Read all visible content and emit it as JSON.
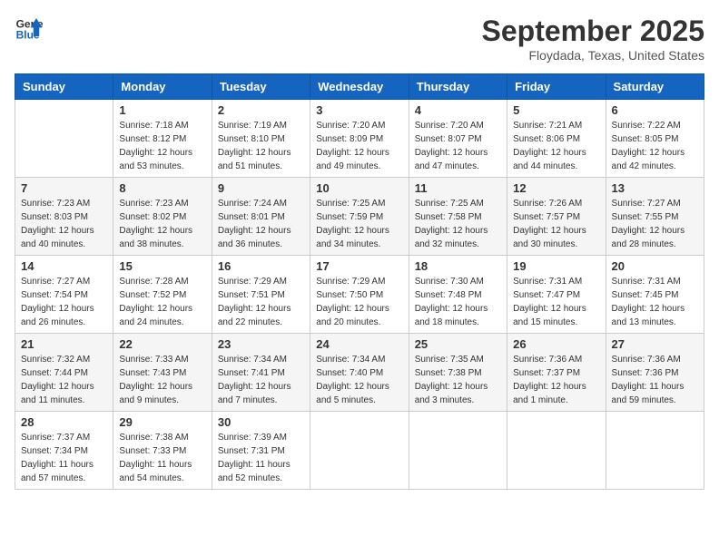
{
  "header": {
    "logo_line1": "General",
    "logo_line2": "Blue",
    "month": "September 2025",
    "location": "Floydada, Texas, United States"
  },
  "weekdays": [
    "Sunday",
    "Monday",
    "Tuesday",
    "Wednesday",
    "Thursday",
    "Friday",
    "Saturday"
  ],
  "weeks": [
    [
      {
        "day": "",
        "info": ""
      },
      {
        "day": "1",
        "info": "Sunrise: 7:18 AM\nSunset: 8:12 PM\nDaylight: 12 hours\nand 53 minutes."
      },
      {
        "day": "2",
        "info": "Sunrise: 7:19 AM\nSunset: 8:10 PM\nDaylight: 12 hours\nand 51 minutes."
      },
      {
        "day": "3",
        "info": "Sunrise: 7:20 AM\nSunset: 8:09 PM\nDaylight: 12 hours\nand 49 minutes."
      },
      {
        "day": "4",
        "info": "Sunrise: 7:20 AM\nSunset: 8:07 PM\nDaylight: 12 hours\nand 47 minutes."
      },
      {
        "day": "5",
        "info": "Sunrise: 7:21 AM\nSunset: 8:06 PM\nDaylight: 12 hours\nand 44 minutes."
      },
      {
        "day": "6",
        "info": "Sunrise: 7:22 AM\nSunset: 8:05 PM\nDaylight: 12 hours\nand 42 minutes."
      }
    ],
    [
      {
        "day": "7",
        "info": "Sunrise: 7:23 AM\nSunset: 8:03 PM\nDaylight: 12 hours\nand 40 minutes."
      },
      {
        "day": "8",
        "info": "Sunrise: 7:23 AM\nSunset: 8:02 PM\nDaylight: 12 hours\nand 38 minutes."
      },
      {
        "day": "9",
        "info": "Sunrise: 7:24 AM\nSunset: 8:01 PM\nDaylight: 12 hours\nand 36 minutes."
      },
      {
        "day": "10",
        "info": "Sunrise: 7:25 AM\nSunset: 7:59 PM\nDaylight: 12 hours\nand 34 minutes."
      },
      {
        "day": "11",
        "info": "Sunrise: 7:25 AM\nSunset: 7:58 PM\nDaylight: 12 hours\nand 32 minutes."
      },
      {
        "day": "12",
        "info": "Sunrise: 7:26 AM\nSunset: 7:57 PM\nDaylight: 12 hours\nand 30 minutes."
      },
      {
        "day": "13",
        "info": "Sunrise: 7:27 AM\nSunset: 7:55 PM\nDaylight: 12 hours\nand 28 minutes."
      }
    ],
    [
      {
        "day": "14",
        "info": "Sunrise: 7:27 AM\nSunset: 7:54 PM\nDaylight: 12 hours\nand 26 minutes."
      },
      {
        "day": "15",
        "info": "Sunrise: 7:28 AM\nSunset: 7:52 PM\nDaylight: 12 hours\nand 24 minutes."
      },
      {
        "day": "16",
        "info": "Sunrise: 7:29 AM\nSunset: 7:51 PM\nDaylight: 12 hours\nand 22 minutes."
      },
      {
        "day": "17",
        "info": "Sunrise: 7:29 AM\nSunset: 7:50 PM\nDaylight: 12 hours\nand 20 minutes."
      },
      {
        "day": "18",
        "info": "Sunrise: 7:30 AM\nSunset: 7:48 PM\nDaylight: 12 hours\nand 18 minutes."
      },
      {
        "day": "19",
        "info": "Sunrise: 7:31 AM\nSunset: 7:47 PM\nDaylight: 12 hours\nand 15 minutes."
      },
      {
        "day": "20",
        "info": "Sunrise: 7:31 AM\nSunset: 7:45 PM\nDaylight: 12 hours\nand 13 minutes."
      }
    ],
    [
      {
        "day": "21",
        "info": "Sunrise: 7:32 AM\nSunset: 7:44 PM\nDaylight: 12 hours\nand 11 minutes."
      },
      {
        "day": "22",
        "info": "Sunrise: 7:33 AM\nSunset: 7:43 PM\nDaylight: 12 hours\nand 9 minutes."
      },
      {
        "day": "23",
        "info": "Sunrise: 7:34 AM\nSunset: 7:41 PM\nDaylight: 12 hours\nand 7 minutes."
      },
      {
        "day": "24",
        "info": "Sunrise: 7:34 AM\nSunset: 7:40 PM\nDaylight: 12 hours\nand 5 minutes."
      },
      {
        "day": "25",
        "info": "Sunrise: 7:35 AM\nSunset: 7:38 PM\nDaylight: 12 hours\nand 3 minutes."
      },
      {
        "day": "26",
        "info": "Sunrise: 7:36 AM\nSunset: 7:37 PM\nDaylight: 12 hours\nand 1 minute."
      },
      {
        "day": "27",
        "info": "Sunrise: 7:36 AM\nSunset: 7:36 PM\nDaylight: 11 hours\nand 59 minutes."
      }
    ],
    [
      {
        "day": "28",
        "info": "Sunrise: 7:37 AM\nSunset: 7:34 PM\nDaylight: 11 hours\nand 57 minutes."
      },
      {
        "day": "29",
        "info": "Sunrise: 7:38 AM\nSunset: 7:33 PM\nDaylight: 11 hours\nand 54 minutes."
      },
      {
        "day": "30",
        "info": "Sunrise: 7:39 AM\nSunset: 7:31 PM\nDaylight: 11 hours\nand 52 minutes."
      },
      {
        "day": "",
        "info": ""
      },
      {
        "day": "",
        "info": ""
      },
      {
        "day": "",
        "info": ""
      },
      {
        "day": "",
        "info": ""
      }
    ]
  ]
}
